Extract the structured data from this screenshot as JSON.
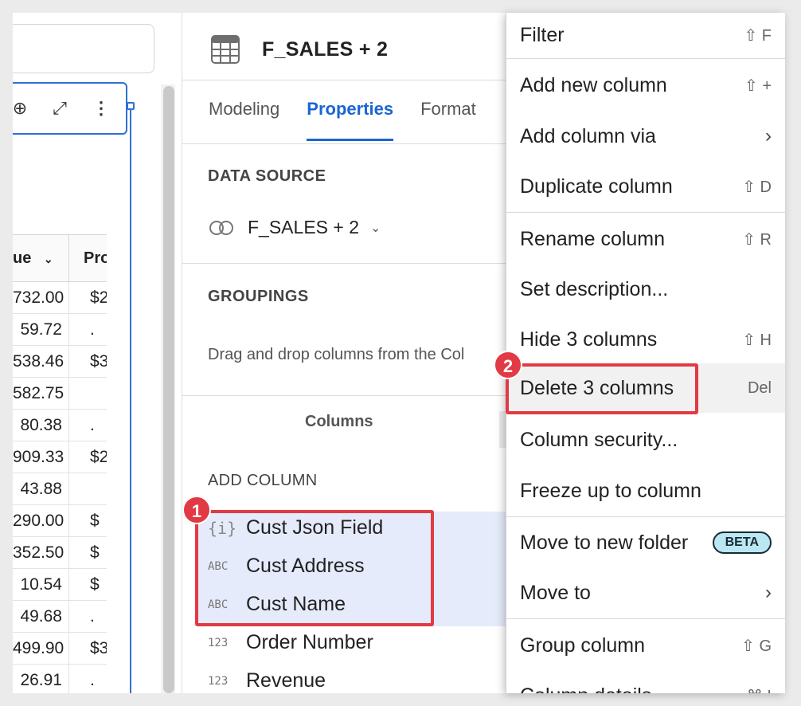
{
  "left_table": {
    "header_col1": "ue",
    "header_col2": "Pro",
    "rows": [
      {
        "c1": "732.00",
        "c2": "$2"
      },
      {
        "c1": "59.72",
        "c2": "."
      },
      {
        "c1": "538.46",
        "c2": "$3"
      },
      {
        "c1": "582.75",
        "c2": ""
      },
      {
        "c1": "80.38",
        "c2": "."
      },
      {
        "c1": "909.33",
        "c2": "$2"
      },
      {
        "c1": "43.88",
        "c2": ""
      },
      {
        "c1": "290.00",
        "c2": "$"
      },
      {
        "c1": "352.50",
        "c2": "$"
      },
      {
        "c1": "10.54",
        "c2": "$"
      },
      {
        "c1": "49.68",
        "c2": "."
      },
      {
        "c1": "499.90",
        "c2": "$3"
      },
      {
        "c1": "26.91",
        "c2": "."
      }
    ]
  },
  "panel": {
    "title": "F_SALES + 2",
    "tabs": [
      "Modeling",
      "Properties",
      "Format"
    ],
    "active_tab": "Properties",
    "data_source_label": "DATA SOURCE",
    "data_source_value": "F_SALES + 2",
    "groupings_label": "GROUPINGS",
    "groupings_hint": "Drag and drop columns from the Col",
    "columns_tab": "Columns",
    "add_column_label": "ADD COLUMN",
    "columns": [
      {
        "type": "{i}",
        "name": "Cust Json Field"
      },
      {
        "type": "ABC",
        "name": "Cust Address"
      },
      {
        "type": "ABC",
        "name": "Cust Name"
      },
      {
        "type": "123",
        "name": "Order Number"
      },
      {
        "type": "123",
        "name": "Revenue"
      }
    ]
  },
  "badges": [
    "1",
    "2"
  ],
  "menu": {
    "items": [
      {
        "label": "Filter",
        "shortcut": "⇧ F"
      },
      {
        "label": "Add new column",
        "shortcut": "⇧ +"
      },
      {
        "label": "Add column via",
        "shortcut": "›"
      },
      {
        "label": "Duplicate column",
        "shortcut": "⇧ D"
      },
      {
        "label": "Rename column",
        "shortcut": "⇧ R"
      },
      {
        "label": "Set description...",
        "shortcut": ""
      },
      {
        "label": "Hide 3 columns",
        "shortcut": "⇧ H"
      },
      {
        "label": "Delete 3 columns",
        "shortcut": "Del"
      },
      {
        "label": "Column security...",
        "shortcut": ""
      },
      {
        "label": "Freeze up to column",
        "shortcut": ""
      },
      {
        "label": "Move to new folder",
        "shortcut": "BETA"
      },
      {
        "label": "Move to",
        "shortcut": "›"
      },
      {
        "label": "Group column",
        "shortcut": "⇧ G"
      },
      {
        "label": "Column details",
        "shortcut": "⌘ I"
      }
    ]
  },
  "colors": {
    "accent": "#1a66d2",
    "highlight": "#e23a44",
    "selection": "#e5ebfa",
    "beta_bg": "#b9e8f2"
  }
}
